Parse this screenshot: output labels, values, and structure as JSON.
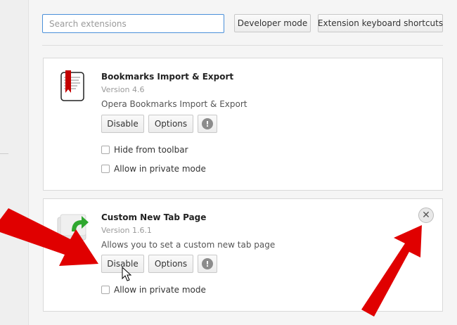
{
  "toolbar": {
    "search_placeholder": "Search extensions",
    "developer_mode": "Developer mode",
    "shortcuts": "Extension keyboard shortcuts"
  },
  "extensions": [
    {
      "name": "Bookmarks Import & Export",
      "version": "Version 4.6",
      "description": "Opera Bookmarks Import & Export",
      "disable": "Disable",
      "options": "Options",
      "info": "!",
      "hide_toolbar": "Hide from toolbar",
      "private_mode": "Allow in private mode"
    },
    {
      "name": "Custom New Tab Page",
      "version": "Version 1.6.1",
      "description": "Allows you to set a custom new tab page",
      "disable": "Disable",
      "options": "Options",
      "info": "!",
      "private_mode": "Allow in private mode",
      "remove": "✕"
    }
  ],
  "colors": {
    "annotation_arrow": "#e00000",
    "search_border": "#4a90d9"
  }
}
